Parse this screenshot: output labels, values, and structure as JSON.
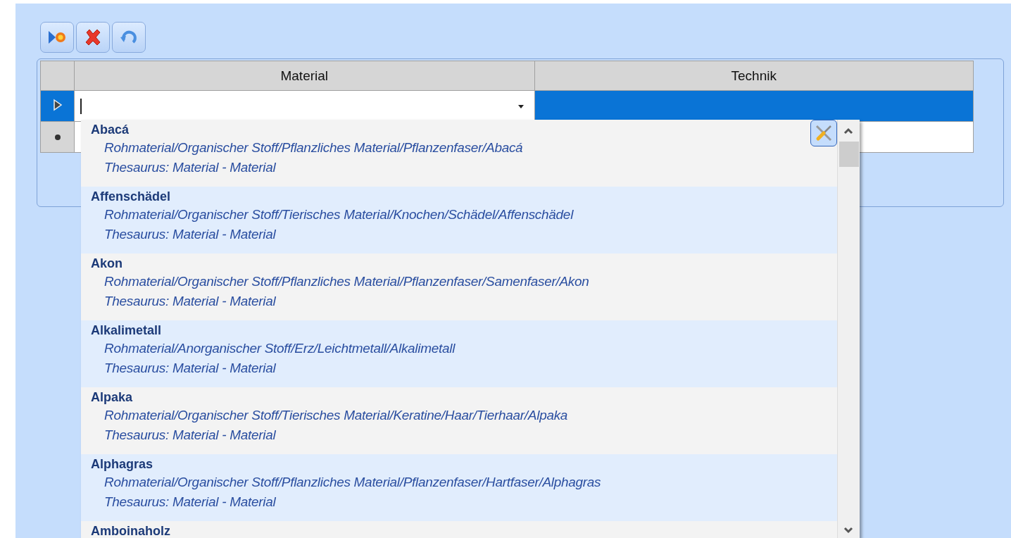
{
  "toolbar": [
    {
      "kind": "new"
    },
    {
      "kind": "delete"
    },
    {
      "kind": "undo"
    }
  ],
  "grid": {
    "columns": [
      "Material",
      "Technik"
    ],
    "rows": [
      {
        "kind": "current",
        "selected": true,
        "cells": [
          "",
          ""
        ]
      },
      {
        "kind": "new",
        "selected": false,
        "cells": [
          "",
          ""
        ]
      }
    ]
  },
  "dropdown": {
    "items": [
      {
        "title": "Abacá",
        "path": "Rohmaterial/Organischer Stoff/Pflanzliches Material/Pflanzenfaser/Abacá",
        "source": "Thesaurus: Material - Material"
      },
      {
        "title": "Affenschädel",
        "path": "Rohmaterial/Organischer Stoff/Tierisches Material/Knochen/Schädel/Affenschädel",
        "source": "Thesaurus: Material - Material"
      },
      {
        "title": "Akon",
        "path": "Rohmaterial/Organischer Stoff/Pflanzliches Material/Pflanzenfaser/Samenfaser/Akon",
        "source": "Thesaurus: Material - Material"
      },
      {
        "title": "Alkalimetall",
        "path": "Rohmaterial/Anorganischer Stoff/Erz/Leichtmetall/Alkalimetall",
        "source": "Thesaurus: Material - Material"
      },
      {
        "title": "Alpaka",
        "path": "Rohmaterial/Organischer Stoff/Tierisches Material/Keratine/Haar/Tierhaar/Alpaka",
        "source": "Thesaurus: Material - Material"
      },
      {
        "title": "Alphagras",
        "path": "Rohmaterial/Organischer Stoff/Pflanzliches Material/Pflanzenfaser/Hartfaser/Alphagras",
        "source": "Thesaurus: Material - Material"
      },
      {
        "title": "Amboinaholz"
      }
    ]
  }
}
